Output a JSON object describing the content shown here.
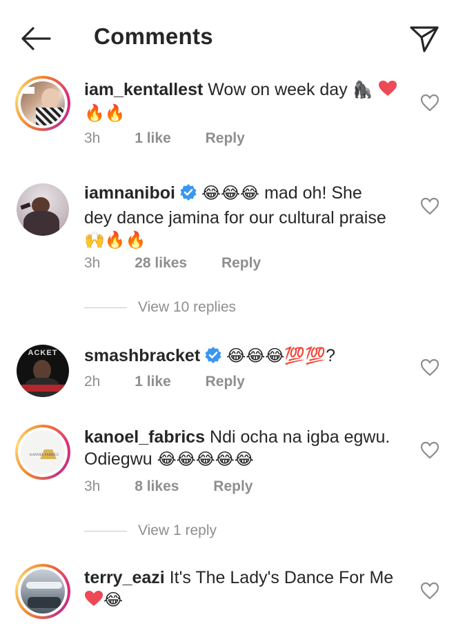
{
  "header": {
    "title": "Comments"
  },
  "comments": [
    {
      "username": "iam_kentallest",
      "text": "Wow on week day",
      "emojis_inline": "🦍",
      "emojis_line2": "🔥🔥",
      "time": "3h",
      "likes": "1 like",
      "reply": "Reply",
      "verified": false
    },
    {
      "username": "iamnaniboi",
      "text_a": "mad oh! She",
      "text_b": "dey dance jamina for our cultural praise",
      "emojis_inline": "😂😂😂",
      "emojis_line3": "🙌🔥🔥",
      "time": "3h",
      "likes": "28 likes",
      "reply": "Reply",
      "verified": true,
      "view_replies": "View 10 replies"
    },
    {
      "username": "smashbracket",
      "emojis_inline": "😂😂😂💯💯",
      "text_suffix": "?",
      "time": "2h",
      "likes": "1 like",
      "reply": "Reply",
      "verified": true
    },
    {
      "username": "kanoel_fabrics",
      "text": "Ndi ocha na igba egwu.",
      "text_b": "Odiegwu",
      "emojis_line2": "😂😂😂😂😂",
      "time": "3h",
      "likes": "8 likes",
      "reply": "Reply",
      "verified": false,
      "view_replies": "View 1 reply"
    },
    {
      "username": "terry_eazi",
      "text": "It's The Lady's Dance For Me",
      "emojis_line2": "😂",
      "verified": false
    }
  ],
  "colors": {
    "text": "#262626",
    "secondary": "#8e8e8e",
    "verified": "#3897f0",
    "heart": "#ed4956",
    "story_ring": "#dd2a7b"
  }
}
